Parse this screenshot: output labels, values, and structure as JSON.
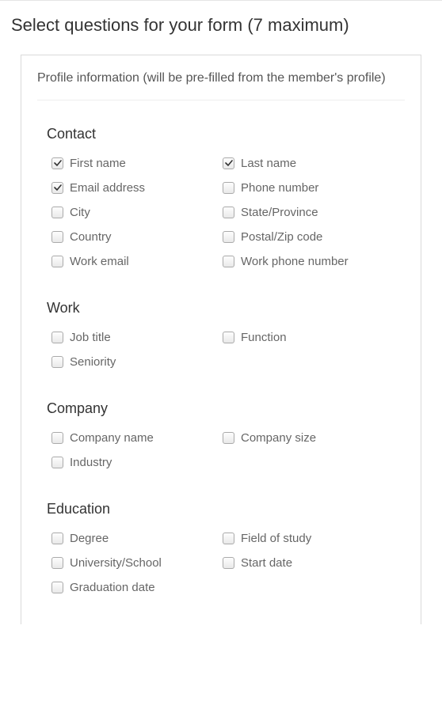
{
  "page_title": "Select questions for your form (7 maximum)",
  "card_description": "Profile information (will be pre-filled from the member's profile)",
  "sections": [
    {
      "title": "Contact",
      "items": [
        {
          "label": "First name",
          "checked": true
        },
        {
          "label": "Last name",
          "checked": true
        },
        {
          "label": "Email address",
          "checked": true
        },
        {
          "label": "Phone number",
          "checked": false
        },
        {
          "label": "City",
          "checked": false
        },
        {
          "label": "State/Province",
          "checked": false
        },
        {
          "label": "Country",
          "checked": false
        },
        {
          "label": "Postal/Zip code",
          "checked": false
        },
        {
          "label": "Work email",
          "checked": false
        },
        {
          "label": "Work phone number",
          "checked": false
        }
      ]
    },
    {
      "title": "Work",
      "items": [
        {
          "label": "Job title",
          "checked": false
        },
        {
          "label": "Function",
          "checked": false
        },
        {
          "label": "Seniority",
          "checked": false
        }
      ]
    },
    {
      "title": "Company",
      "items": [
        {
          "label": "Company name",
          "checked": false
        },
        {
          "label": "Company size",
          "checked": false
        },
        {
          "label": "Industry",
          "checked": false
        }
      ]
    },
    {
      "title": "Education",
      "items": [
        {
          "label": "Degree",
          "checked": false
        },
        {
          "label": "Field of study",
          "checked": false
        },
        {
          "label": "University/School",
          "checked": false
        },
        {
          "label": "Start date",
          "checked": false
        },
        {
          "label": "Graduation date",
          "checked": false
        }
      ]
    }
  ]
}
